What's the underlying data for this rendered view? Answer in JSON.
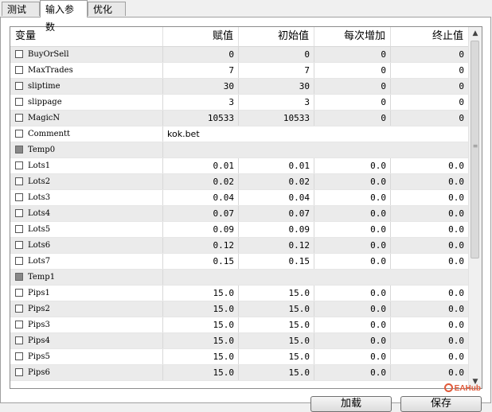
{
  "tabs": [
    {
      "label": "测试"
    },
    {
      "label": "输入参数"
    },
    {
      "label": "优化"
    }
  ],
  "active_tab_index": 1,
  "table": {
    "columns": [
      "变量",
      "赋值",
      "初始值",
      "每次增加",
      "终止值"
    ],
    "rows": [
      {
        "name": "BuyOrSell",
        "value": "0",
        "start": "0",
        "step": "0",
        "stop": "0",
        "group": false,
        "alt": true
      },
      {
        "name": "MaxTrades",
        "value": "7",
        "start": "7",
        "step": "0",
        "stop": "0",
        "group": false,
        "alt": false
      },
      {
        "name": "sliptime",
        "value": "30",
        "start": "30",
        "step": "0",
        "stop": "0",
        "group": false,
        "alt": true
      },
      {
        "name": "slippage",
        "value": "3",
        "start": "3",
        "step": "0",
        "stop": "0",
        "group": false,
        "alt": false
      },
      {
        "name": "MagicN",
        "value": "10533",
        "start": "10533",
        "step": "0",
        "stop": "0",
        "group": false,
        "alt": true
      },
      {
        "name": "Commentt",
        "value": "kok.bet",
        "start": "",
        "step": "",
        "stop": "",
        "group": false,
        "alt": false,
        "text": true
      },
      {
        "name": "Temp0",
        "value": "",
        "start": "",
        "step": "",
        "stop": "",
        "group": true,
        "alt": true
      },
      {
        "name": "Lots1",
        "value": "0.01",
        "start": "0.01",
        "step": "0.0",
        "stop": "0.0",
        "group": false,
        "alt": false
      },
      {
        "name": "Lots2",
        "value": "0.02",
        "start": "0.02",
        "step": "0.0",
        "stop": "0.0",
        "group": false,
        "alt": true
      },
      {
        "name": "Lots3",
        "value": "0.04",
        "start": "0.04",
        "step": "0.0",
        "stop": "0.0",
        "group": false,
        "alt": false
      },
      {
        "name": "Lots4",
        "value": "0.07",
        "start": "0.07",
        "step": "0.0",
        "stop": "0.0",
        "group": false,
        "alt": true
      },
      {
        "name": "Lots5",
        "value": "0.09",
        "start": "0.09",
        "step": "0.0",
        "stop": "0.0",
        "group": false,
        "alt": false
      },
      {
        "name": "Lots6",
        "value": "0.12",
        "start": "0.12",
        "step": "0.0",
        "stop": "0.0",
        "group": false,
        "alt": true
      },
      {
        "name": "Lots7",
        "value": "0.15",
        "start": "0.15",
        "step": "0.0",
        "stop": "0.0",
        "group": false,
        "alt": false
      },
      {
        "name": "Temp1",
        "value": "",
        "start": "",
        "step": "",
        "stop": "",
        "group": true,
        "alt": true
      },
      {
        "name": "Pips1",
        "value": "15.0",
        "start": "15.0",
        "step": "0.0",
        "stop": "0.0",
        "group": false,
        "alt": false
      },
      {
        "name": "Pips2",
        "value": "15.0",
        "start": "15.0",
        "step": "0.0",
        "stop": "0.0",
        "group": false,
        "alt": true
      },
      {
        "name": "Pips3",
        "value": "15.0",
        "start": "15.0",
        "step": "0.0",
        "stop": "0.0",
        "group": false,
        "alt": false
      },
      {
        "name": "Pips4",
        "value": "15.0",
        "start": "15.0",
        "step": "0.0",
        "stop": "0.0",
        "group": false,
        "alt": true
      },
      {
        "name": "Pips5",
        "value": "15.0",
        "start": "15.0",
        "step": "0.0",
        "stop": "0.0",
        "group": false,
        "alt": false
      },
      {
        "name": "Pips6",
        "value": "15.0",
        "start": "15.0",
        "step": "0.0",
        "stop": "0.0",
        "group": false,
        "alt": true
      }
    ]
  },
  "buttons": {
    "load": "加载",
    "save": "保存"
  },
  "watermark": "EAHub",
  "icons": {
    "scroll_up": "scroll-up-arrow-icon",
    "scroll_down": "scroll-down-arrow-icon",
    "checkbox": "checkbox-icon"
  },
  "colors": {
    "alt_row": "#ebebeb",
    "watermark": "#e05a3a"
  }
}
